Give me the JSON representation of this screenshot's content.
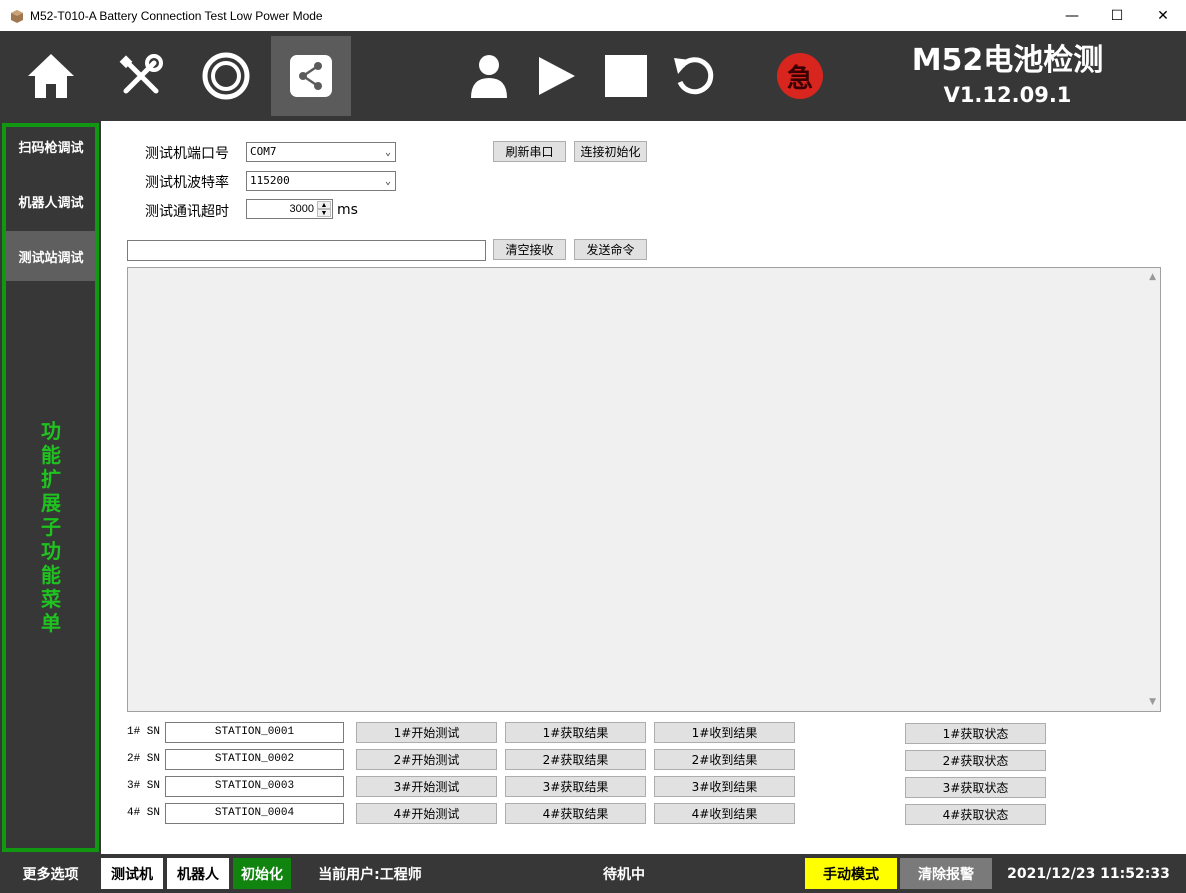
{
  "window": {
    "title": "M52-T010-A Battery Connection Test Low Power Mode",
    "minimize": "—",
    "maximize": "☐",
    "close": "✕"
  },
  "toolbar": {
    "icons": [
      "home-icon",
      "tools-icon",
      "camera-lens-icon",
      "share-icon",
      "user-icon",
      "play-icon",
      "stop-icon",
      "reset-icon"
    ],
    "emergency_label": "急",
    "brand_name": "M52电池检测",
    "version": "V1.12.09.1",
    "emergency_color": "#d8261f",
    "bar_color": "#373737"
  },
  "sidebar": {
    "items": [
      {
        "label": "扫码枪调试"
      },
      {
        "label": "机器人调试"
      },
      {
        "label": "测试站调试"
      }
    ],
    "vertical_label": "功能扩展子功能菜单",
    "frame_color": "#129712",
    "label_color": "#1fc31f"
  },
  "settings": {
    "port_label": "测试机端口号",
    "port_value": "COM7",
    "baud_label": "测试机波特率",
    "baud_value": "115200",
    "timeout_label": "测试通讯超时",
    "timeout_value": "3000",
    "timeout_unit": "ms",
    "refresh_button": "刷新串口",
    "connect_button": "连接初始化"
  },
  "command": {
    "input_value": "",
    "clear_button": "清空接收",
    "send_button": "发送命令"
  },
  "stations": [
    {
      "label": "1# SN",
      "sn": "STATION_0001",
      "start": "1#开始测试",
      "get_result": "1#获取结果",
      "received": "1#收到结果",
      "status": "1#获取状态"
    },
    {
      "label": "2# SN",
      "sn": "STATION_0002",
      "start": "2#开始测试",
      "get_result": "2#获取结果",
      "received": "2#收到结果",
      "status": "2#获取状态"
    },
    {
      "label": "3# SN",
      "sn": "STATION_0003",
      "start": "3#开始测试",
      "get_result": "3#获取结果",
      "received": "3#收到结果",
      "status": "3#获取状态"
    },
    {
      "label": "4# SN",
      "sn": "STATION_0004",
      "start": "4#开始测试",
      "get_result": "4#获取结果",
      "received": "4#收到结果",
      "status": "4#获取状态"
    }
  ],
  "statusbar": {
    "more": "更多选项",
    "tester": "测试机",
    "robot": "机器人",
    "init": "初始化",
    "user": "当前用户:工程师",
    "state": "待机中",
    "mode": "手动模式",
    "clear_alarm": "清除报警",
    "datetime": "2021/12/23 11:52:33",
    "mode_color": "#ffff00",
    "init_color": "#11840f"
  }
}
